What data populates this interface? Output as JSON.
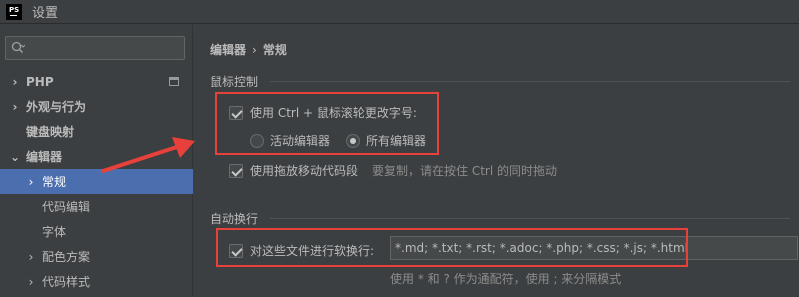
{
  "window": {
    "icon_text": "PS",
    "title": "设置"
  },
  "search": {
    "placeholder": ""
  },
  "sidebar": {
    "items": [
      {
        "label": "PHP",
        "chevron": "›"
      },
      {
        "label": "外观与行为",
        "chevron": "›"
      },
      {
        "label": "键盘映射",
        "chevron": ""
      },
      {
        "label": "编辑器",
        "chevron": "⌄"
      },
      {
        "label": "常规",
        "chevron": "›"
      },
      {
        "label": "代码编辑",
        "chevron": ""
      },
      {
        "label": "字体",
        "chevron": ""
      },
      {
        "label": "配色方案",
        "chevron": "›"
      },
      {
        "label": "代码样式",
        "chevron": "›"
      }
    ]
  },
  "breadcrumb": {
    "parent": "编辑器",
    "separator": "›",
    "current": "常规"
  },
  "mouse_section": {
    "title": "鼠标控制",
    "ctrl_wheel_label": "使用 Ctrl + 鼠标滚轮更改字号:",
    "ctrl_wheel_checked": true,
    "radio_active_label": "活动编辑器",
    "radio_all_label": "所有编辑器",
    "selected_radio": "所有编辑器",
    "drag_label": "使用拖放移动代码段",
    "drag_checked": true,
    "drag_hint": "要复制，请在按住 Ctrl 的同时拖动"
  },
  "softwrap_section": {
    "title": "自动换行",
    "files_label": "对这些文件进行软换行:",
    "files_checked": true,
    "files_value": "*.md; *.txt; *.rst; *.adoc; *.php; *.css; *.js; *.html",
    "files_hint": "使用 * 和 ? 作为通配符，使用 ; 来分隔模式"
  },
  "colors": {
    "background": "#3c3f41",
    "selection": "#4b6eaf",
    "annotation_red": "#e8403a"
  }
}
